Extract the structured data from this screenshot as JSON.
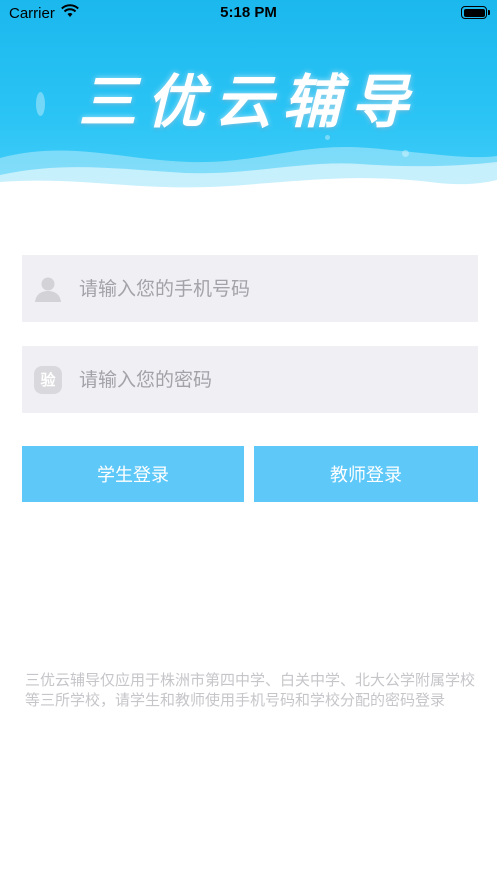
{
  "status_bar": {
    "carrier": "Carrier",
    "time": "5:18 PM"
  },
  "app": {
    "title": "三优云辅导"
  },
  "login": {
    "phone_placeholder": "请输入您的手机号码",
    "password_placeholder": "请输入您的密码",
    "verify_badge": "验",
    "student_login": "学生登录",
    "teacher_login": "教师登录"
  },
  "notice": {
    "text": "三优云辅导仅应用于株洲市第四中学、白关中学、北大公学附属学校等三所学校，请学生和教师使用手机号码和学校分配的密码登录"
  },
  "colors": {
    "banner": "#1bb8ee",
    "button": "#5ec8f8",
    "field_bg": "#efeff4",
    "notice_text": "#c6c6ca"
  }
}
